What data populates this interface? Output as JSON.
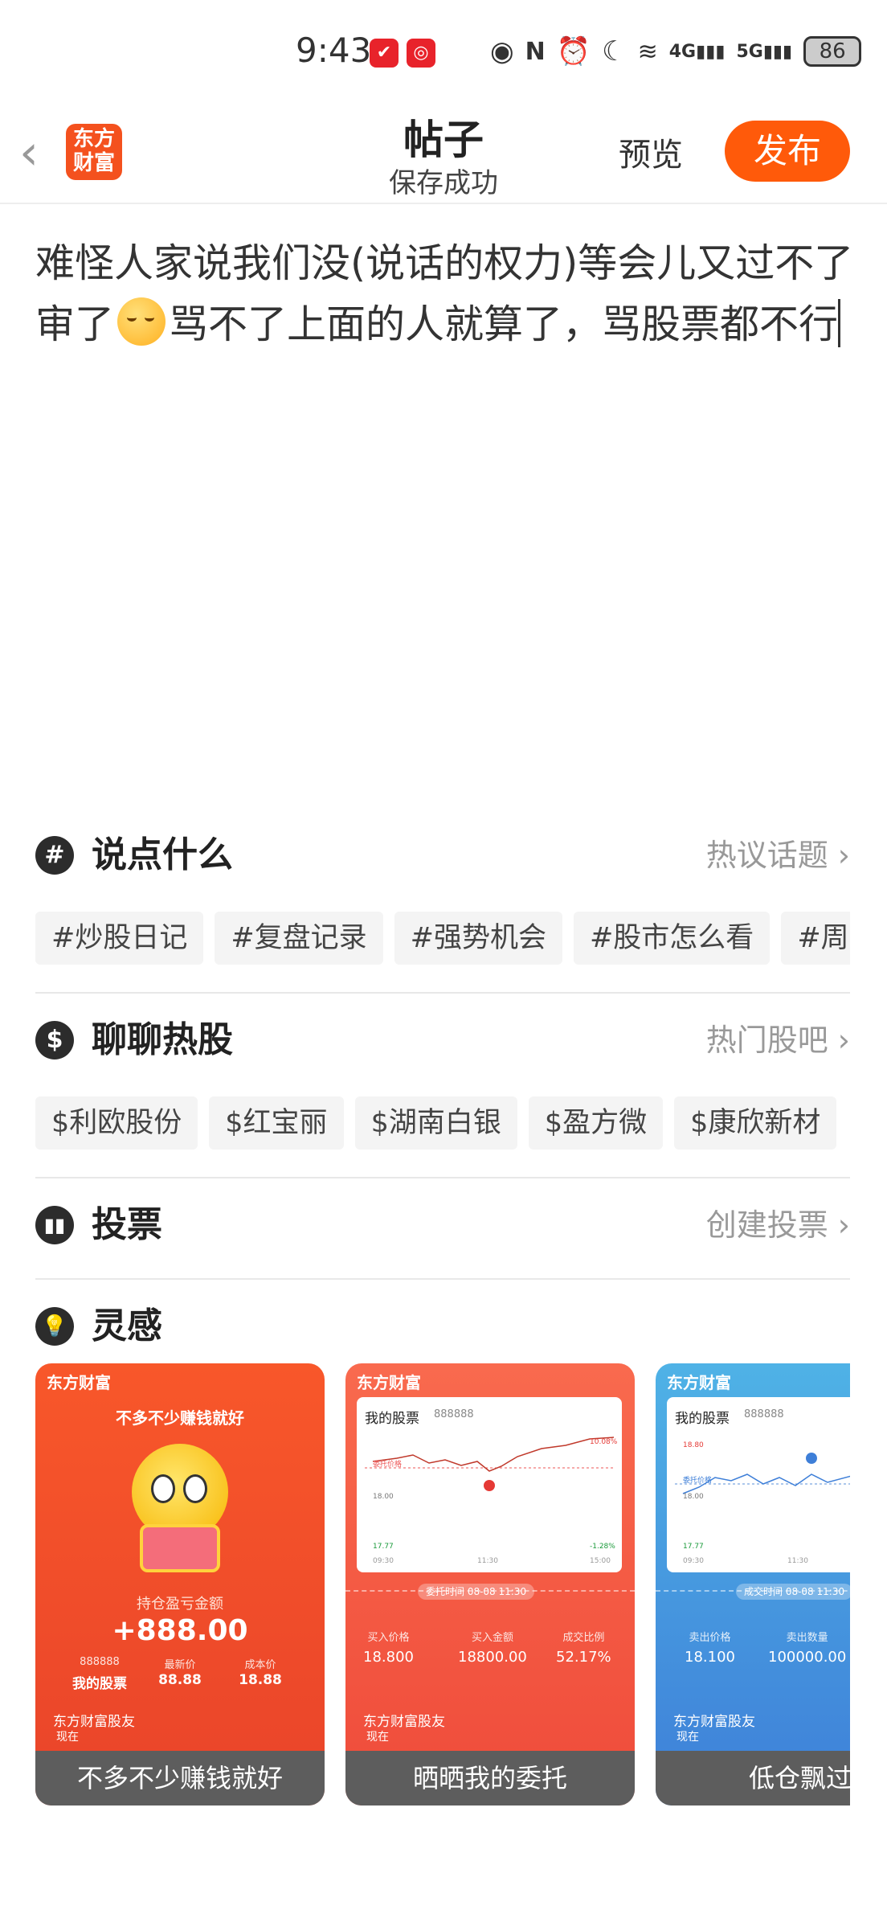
{
  "status_bar": {
    "time": "9:43",
    "battery": "86",
    "net1": "4G",
    "net2": "5G"
  },
  "nav": {
    "logo_line1": "东方",
    "logo_line2": "财富",
    "title": "帖子",
    "subtitle": "保存成功",
    "preview": "预览",
    "publish": "发布"
  },
  "editor": {
    "text_part1": "难怪人家说我们没(说话的权力)等会儿又过不了审了",
    "text_part2": "骂不了上面的人就算了，骂股票都不行"
  },
  "topics": {
    "icon": "#",
    "title": "说点什么",
    "link": "热议话题",
    "chips": [
      "#炒股日记",
      "#复盘记录",
      "#强势机会",
      "#股市怎么看",
      "#周"
    ]
  },
  "hot_stocks": {
    "icon": "$",
    "title": "聊聊热股",
    "link": "热门股吧",
    "chips": [
      "$利欧股份",
      "$红宝丽",
      "$湖南白银",
      "$盈方微",
      "$康欣新材"
    ]
  },
  "vote": {
    "title": "投票",
    "link": "创建投票"
  },
  "inspiration": {
    "title": "灵感",
    "brand": "东方财富",
    "card1": {
      "headline": "不多不少赚钱就好",
      "amount_label": "持仓盈亏金额",
      "amount": "+888.00",
      "code": "888888",
      "name": "我的股票",
      "price_label": "最新价",
      "price": "88.88",
      "cost_label": "成本价",
      "cost": "18.88",
      "user": "东方财富股友",
      "time": "现在",
      "footer": "不多不少赚钱就好"
    },
    "card2": {
      "panel_title": "我的股票",
      "panel_code": "888888",
      "pct_top": "10.08%",
      "pct_bottom": "-1.28%",
      "y_top": "18.00",
      "y_bottom": "17.77",
      "order_label": "委托价格",
      "t1": "09:30",
      "t2": "11:30",
      "t3": "15:00",
      "tag": "委托时间 08-08 11:30",
      "k1": "买入价格",
      "v1": "18.800",
      "k2": "买入金额",
      "v2": "18800.00",
      "k3": "成交比例",
      "v3": "52.17%",
      "user": "东方财富股友",
      "time": "现在",
      "footer": "晒晒我的委托"
    },
    "card3": {
      "panel_title": "我的股票",
      "panel_code": "888888",
      "y_top": "18.80",
      "y_mid": "18.00",
      "y_bottom": "17.77",
      "order_label": "委托价格",
      "t1": "09:30",
      "t2": "11:30",
      "tag": "成交时间 08-08 11:30",
      "k1": "卖出价格",
      "v1": "18.100",
      "k2": "卖出数量",
      "v2": "100000.00",
      "user": "东方财富股友",
      "time": "现在",
      "footer": "低仓飘过"
    }
  },
  "colors": {
    "accent": "#ff5a0a",
    "chip_bg": "#f4f4f4",
    "card_footer": "#5d5d5d"
  }
}
